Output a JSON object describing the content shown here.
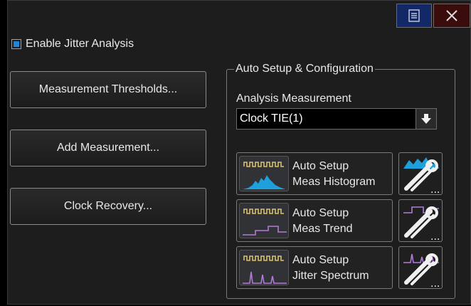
{
  "title_bar": {
    "menu_icon": "menu-icon",
    "close_icon": "close-icon"
  },
  "enable_jitter": {
    "label": "Enable Jitter Analysis",
    "checked": true
  },
  "buttons": {
    "measurement_thresholds": "Measurement Thresholds...",
    "add_measurement": "Add Measurement...",
    "clock_recovery": "Clock Recovery..."
  },
  "auto_setup": {
    "group_label": "Auto Setup & Configuration",
    "analysis_label": "Analysis Measurement",
    "analysis_value": "Clock TIE(1)",
    "items": [
      {
        "line1": "Auto Setup",
        "line2": "Meas Histogram",
        "icon": "histogram-icon"
      },
      {
        "line1": "Auto Setup",
        "line2": "Meas Trend",
        "icon": "trend-icon"
      },
      {
        "line1": "Auto Setup",
        "line2": "Jitter Spectrum",
        "icon": "spectrum-icon"
      }
    ],
    "tool_icon": "wrench-screwdriver-icon",
    "tool_ellipsis": "..."
  },
  "colors": {
    "checkbox_fill": "#1f86d6",
    "pulse": "#d8c070",
    "histogram": "#1ea0dc",
    "trend": "#b27ad8",
    "spectrum": "#b27ad8"
  }
}
